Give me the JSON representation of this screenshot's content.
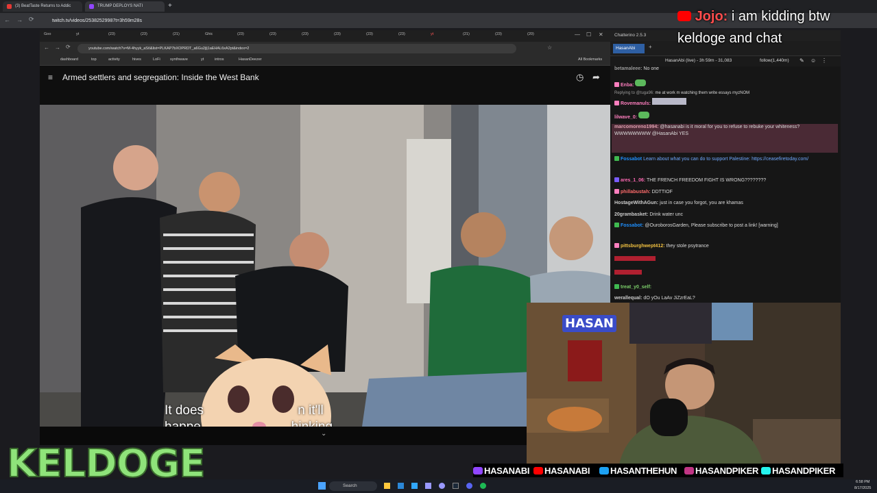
{
  "outer_browser": {
    "tabs": [
      {
        "label": "(3) BeatTaste Returns to Addic",
        "color": "#e53935"
      },
      {
        "label": "TRUMP DEPLOYS NATI",
        "color": "#9146ff"
      }
    ],
    "url": "twitch.tv/videos/25382529987t=3h59m28s"
  },
  "inner_browser": {
    "tabs": [
      "Goo",
      "yt",
      "(23)",
      "(23)",
      "(21)",
      "Ghic",
      "(23)",
      "(23)",
      "(23)",
      "(23)",
      "(23)",
      "(23)",
      "yt",
      "(21)",
      "(23)",
      "(20)"
    ],
    "url": "youtube.com/watch?v=M-4hyyk_aStI&list=PLKAP7bXOPRDT_a6Gu2jlj1aEHAL6xA2pt&index=2",
    "bookmarks": [
      "dashboard",
      "top",
      "activity",
      "hives",
      "LoFi",
      "synthwave",
      "yt",
      "intros",
      "HasanDeezer"
    ],
    "all_bookmarks": "All Bookmarks"
  },
  "youtube": {
    "title": "Armed settlers and segregation: Inside the West Bank",
    "caption_line1": "It does                          n it'll",
    "caption_line2": "happe                         hinking."
  },
  "chat": {
    "app_title": "Chatterino 2.5.3",
    "tab_label": "HasanAbi",
    "header": "HasanAbi (live) - 3h 59m - 31,083",
    "follow": "follow(1,440m)",
    "messages": [
      {
        "user": "betamaleee:",
        "text": "No one",
        "color": "#9b9b9b"
      },
      {
        "user": "Enba:",
        "text": "",
        "color": "#ff7fbf"
      },
      {
        "user": "Replying to @tuga96:",
        "text": "me at work m watching them write essays myzNOM",
        "color": "#9b9b9b"
      },
      {
        "user": "Rovemanuls:",
        "text": "",
        "color": "#ff7fbf"
      },
      {
        "user": "lilwave_0:",
        "text": "",
        "color": "#ff7fbf"
      },
      {
        "user": "marcomoreno1994:",
        "text": "@hasanabi is it moral for you to refuse to rebuke your whiteness?",
        "color": "#d8a"
      },
      {
        "user": "",
        "text": "WWWWWWWW @HasanAbi YES",
        "color": "#cc44ff"
      },
      {
        "user": "Fossabot",
        "text": "Learn about what you can do to support Palestine: https://ceasefiretoday.com/",
        "color": "#1e90ff"
      },
      {
        "user": "ares_1_06:",
        "text": "THE FRENCH FREEDOM FIGHT IS WRONG????????",
        "color": "#ff69b4"
      },
      {
        "user": "phillabustah:",
        "text": "DDTTIOF",
        "color": "#ff6b6b"
      },
      {
        "user": "HostageWithAGun:",
        "text": "just in case you forgot, you are khamas",
        "color": "#ccc"
      },
      {
        "user": "20grambasket:",
        "text": "Drink water unc",
        "color": "#ccc"
      },
      {
        "user": "Fossabot:",
        "text": "@OuroborosGarden, Please subscribe to post a link! [warning]",
        "color": "#1e90ff"
      },
      {
        "user": "pittsburghwept412:",
        "text": "they stole psytrance",
        "color": "#f0c040"
      },
      {
        "user": "treat_y0_self:",
        "text": "",
        "color": "#7ccf6a"
      },
      {
        "user": "werallequal:",
        "text": "dO yOu LaAv JiZzrEaL?",
        "color": "#ccc"
      }
    ]
  },
  "overlay": {
    "speaker": "Jojo:",
    "message": "i am kidding btw",
    "line2": "keldoge and chat"
  },
  "webcam_sign": "HASAN",
  "socials": [
    {
      "handle": "HASANABI",
      "color": "#9146ff"
    },
    {
      "handle": "HASANABI",
      "color": "#ff0000"
    },
    {
      "handle": "HASANTHEHUN",
      "color": "#1da1f2"
    },
    {
      "handle": "HASANDPIKER",
      "color": "#c13584"
    },
    {
      "handle": "HASANDPIKER",
      "color": "#ffffff"
    }
  ],
  "brand_text": "KELDOGE",
  "taskbar": {
    "search": "Search",
    "time": "6:58 PM",
    "date": "8/17/2025"
  }
}
